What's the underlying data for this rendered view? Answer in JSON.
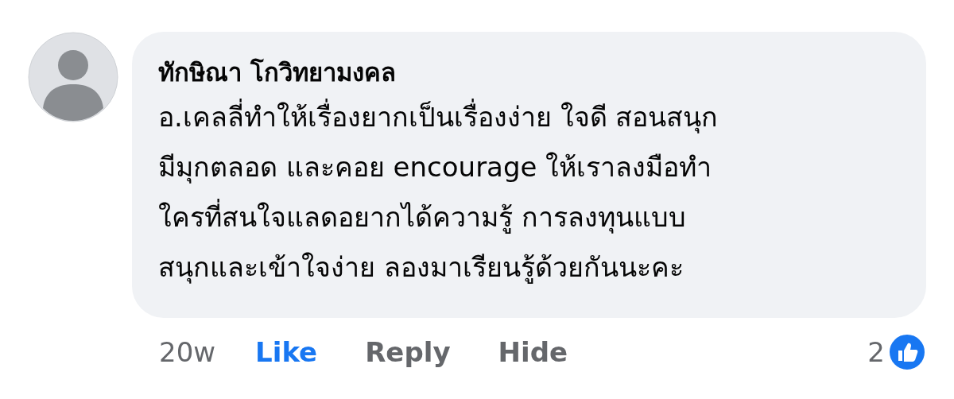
{
  "comment": {
    "author": "ทักษิณา โกวิทยามงคล",
    "text": "อ.เคลลี่ทำให้เรื่องยากเป็นเรื่องง่าย ใจดี สอนสนุก\nมีมุกตลอด และคอย encourage ให้เราลงมือทำ\nใครที่สนใจแลดอยากได้ความรู้ การลงทุนแบบ\nสนุกและเข้าใจง่าย ลองมาเรียนรู้ด้วยกันนะคะ",
    "time": "20w",
    "liked": true,
    "actions": [
      {
        "label": "Like",
        "kind": "like"
      },
      {
        "label": "Reply",
        "kind": "reply"
      },
      {
        "label": "Hide",
        "kind": "hide"
      }
    ],
    "reaction_count": "2"
  }
}
